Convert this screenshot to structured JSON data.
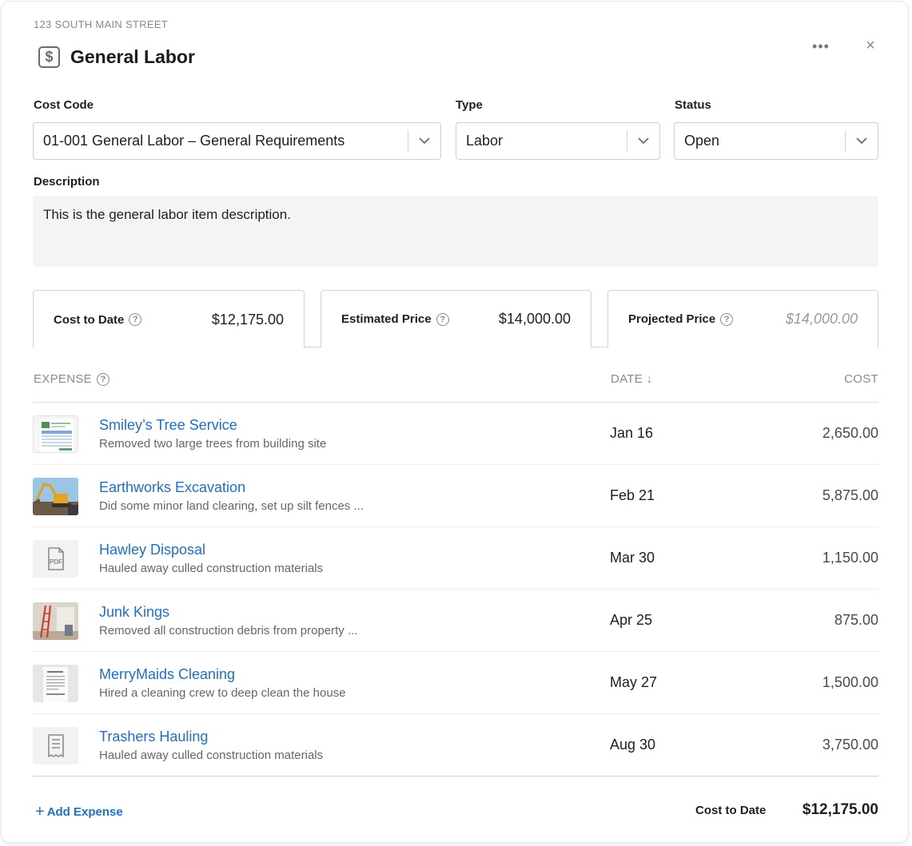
{
  "header": {
    "address": "123 SOUTH MAIN STREET",
    "title": "General Labor",
    "title_icon": "dollar-document-icon",
    "more_label": "•••",
    "close_label": "×"
  },
  "fields": {
    "cost_code": {
      "label": "Cost Code",
      "value": "01-001 General Labor – General Requirements"
    },
    "type": {
      "label": "Type",
      "value": "Labor"
    },
    "status": {
      "label": "Status",
      "value": "Open"
    },
    "description": {
      "label": "Description",
      "value": "This is the general labor item description."
    }
  },
  "tabs": [
    {
      "label": "Cost to Date",
      "amount": "$12,175.00",
      "active": true
    },
    {
      "label": "Estimated Price",
      "amount": "$14,000.00",
      "active": false
    },
    {
      "label": "Projected Price",
      "amount": "$14,000.00",
      "active": false
    }
  ],
  "table": {
    "columns": {
      "expense": "EXPENSE",
      "date": "DATE ↓",
      "cost": "COST"
    },
    "rows": [
      {
        "vendor": "Smiley’s Tree Service",
        "note": "Removed two large trees from building site",
        "date": "Jan 16",
        "cost": "2,650.00",
        "thumb": "invoice-thumbnail"
      },
      {
        "vendor": "Earthworks Excavation",
        "note": "Did some minor land clearing, set up silt fences ...",
        "date": "Feb 21",
        "cost": "5,875.00",
        "thumb": "excavator-photo-thumbnail"
      },
      {
        "vendor": "Hawley Disposal",
        "note": "Hauled away culled construction materials",
        "date": "Mar 30",
        "cost": "1,150.00",
        "thumb": "pdf-icon"
      },
      {
        "vendor": "Junk Kings",
        "note": "Removed all construction debris from property ...",
        "date": "Apr 25",
        "cost": "875.00",
        "thumb": "room-ladder-photo-thumbnail"
      },
      {
        "vendor": "MerryMaids Cleaning",
        "note": "Hired a cleaning crew to deep clean the house",
        "date": "May 27",
        "cost": "1,500.00",
        "thumb": "receipt-thumbnail"
      },
      {
        "vendor": "Trashers Hauling",
        "note": "Hauled away culled construction materials",
        "date": "Aug 30",
        "cost": "3,750.00",
        "thumb": "receipt-icon"
      }
    ]
  },
  "footer": {
    "add_expense": "Add Expense",
    "total_label": "Cost to Date",
    "total_value": "$12,175.00"
  },
  "colors": {
    "link": "#1f6fc6",
    "muted": "#8a8a8a",
    "text": "#1f1f1f"
  }
}
